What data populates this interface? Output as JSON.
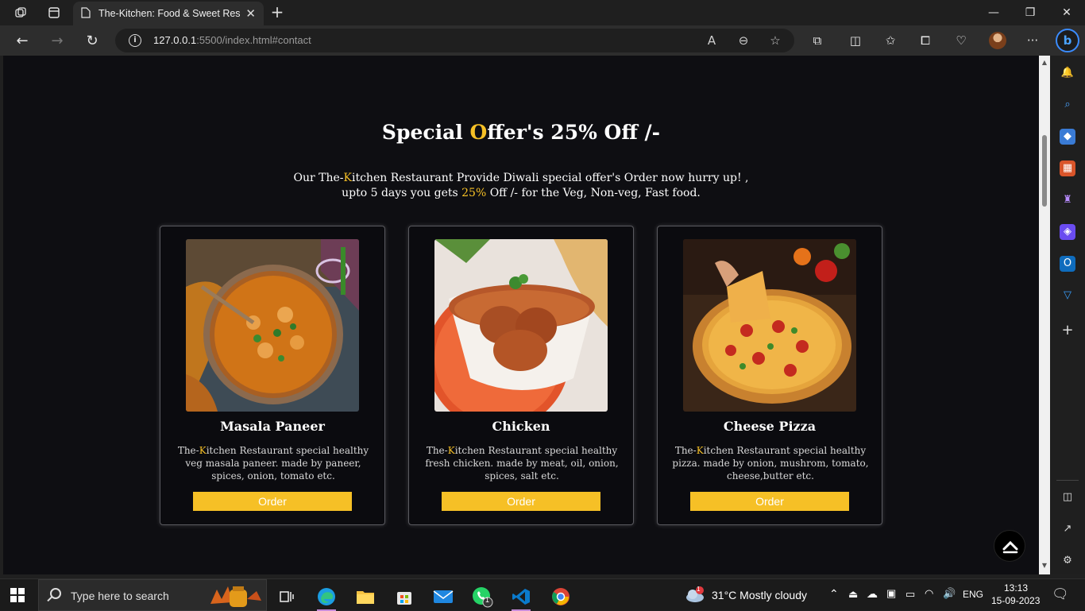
{
  "browser": {
    "tab_title": "The-Kitchen: Food & Sweet Resto",
    "url_host": "127.0.0.1",
    "url_rest": ":5500/index.html#contact"
  },
  "page": {
    "heading_part1": "Special ",
    "heading_accent": "O",
    "heading_part2": "ffer's 25% Off /-",
    "intro_line1_a": "Our The-",
    "intro_line1_accent": "K",
    "intro_line1_b": "itchen Restaurant Provide Diwali special offer's Order now hurry up! ,",
    "intro_line2_a": "upto 5 days you gets ",
    "intro_line2_accent": "25%",
    "intro_line2_b": " Off /- for the Veg, Non-veg, Fast food.",
    "cards": [
      {
        "title": "Masala Paneer",
        "desc_prefix": "The-",
        "desc_accent": "K",
        "desc_text": "itchen Restaurant special healthy veg masala paneer. made by paneer, spices, onion, tomato etc.",
        "button": "Order"
      },
      {
        "title": "Chicken",
        "desc_prefix": "The-",
        "desc_accent": "K",
        "desc_text": "itchen Restaurant special healthy fresh chicken. made by meat, oil, onion, spices, salt etc.",
        "button": "Order"
      },
      {
        "title": "Cheese Pizza",
        "desc_prefix": "The-",
        "desc_accent": "K",
        "desc_text": "itchen Restaurant special healthy pizza. made by onion, mushrom, tomato, cheese,butter etc.",
        "button": "Order"
      }
    ]
  },
  "taskbar": {
    "search_placeholder": "Type here to search",
    "weather": "31°C  Mostly cloudy",
    "weather_badge": "1",
    "lang": "ENG",
    "time": "13:13",
    "date": "15-09-2023",
    "whatsapp_badge": "1"
  },
  "colors": {
    "accent": "#f6c026",
    "page_bg": "#0e0e12"
  }
}
